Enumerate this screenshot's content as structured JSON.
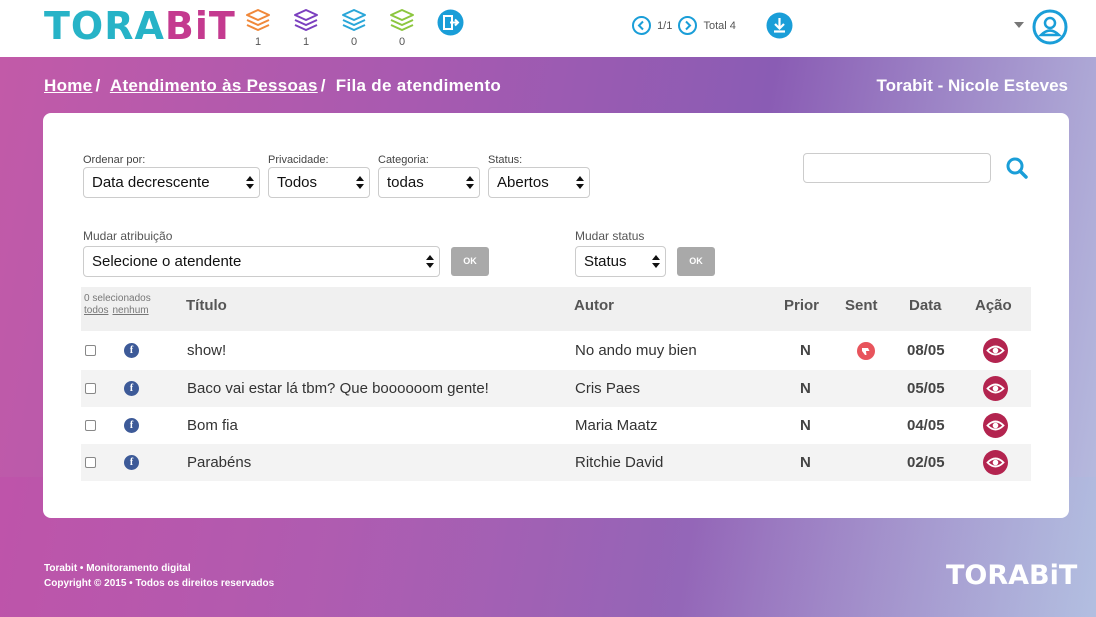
{
  "header": {
    "logo_part1": "TORA",
    "logo_part2": "BiT",
    "counters": [
      {
        "icon": "orange-stack-icon",
        "color": "#f0883a",
        "count": "1"
      },
      {
        "icon": "purple-stack-icon",
        "color": "#7b3fbf",
        "count": "1"
      },
      {
        "icon": "blue-stack-icon",
        "color": "#2aa6d8",
        "count": "0"
      },
      {
        "icon": "green-stack-icon",
        "color": "#8cc63f",
        "count": "0"
      }
    ],
    "pager": {
      "page": "1/1",
      "total": "Total 4"
    },
    "accent": "#1a9ed8"
  },
  "breadcrumb": {
    "home": "Home",
    "section": "Atendimento às Pessoas",
    "current": "Fila de atendimento"
  },
  "user_name": "Torabit - Nicole Esteves",
  "filters": {
    "order_label": "Ordenar por:",
    "order_value": "Data decrescente",
    "privacy_label": "Privacidade:",
    "privacy_value": "Todos",
    "category_label": "Categoria:",
    "category_value": "todas",
    "status_label": "Status:",
    "status_value": "Abertos",
    "search_value": ""
  },
  "bulk": {
    "assign_label": "Mudar atribuição",
    "assign_value": "Selecione o atendente",
    "status_label": "Mudar status",
    "status_value": "Status",
    "ok_label": "OK"
  },
  "table": {
    "selected_text": "0 selecionados",
    "select_all": "todos",
    "select_none": "nenhum",
    "columns": [
      "Título",
      "Autor",
      "Prior",
      "Sent",
      "Data",
      "Ação"
    ],
    "rows": [
      {
        "title": "show!",
        "author": "No ando muy bien",
        "prior": "N",
        "sentiment": "negative",
        "date": "08/05"
      },
      {
        "title": "Baco vai estar lá tbm? Que boooooom gente!",
        "author": "Cris Paes",
        "prior": "N",
        "sentiment": "",
        "date": "05/05"
      },
      {
        "title": "Bom fia",
        "author": "Maria Maatz",
        "prior": "N",
        "sentiment": "",
        "date": "04/05"
      },
      {
        "title": "Parabéns",
        "author": "Ritchie David",
        "prior": "N",
        "sentiment": "",
        "date": "02/05"
      }
    ]
  },
  "footer": {
    "line1": "Torabit • Monitoramento digital",
    "line2": "Copyright © 2015 • Todos os direitos reservados",
    "logo": "TORABiT"
  }
}
